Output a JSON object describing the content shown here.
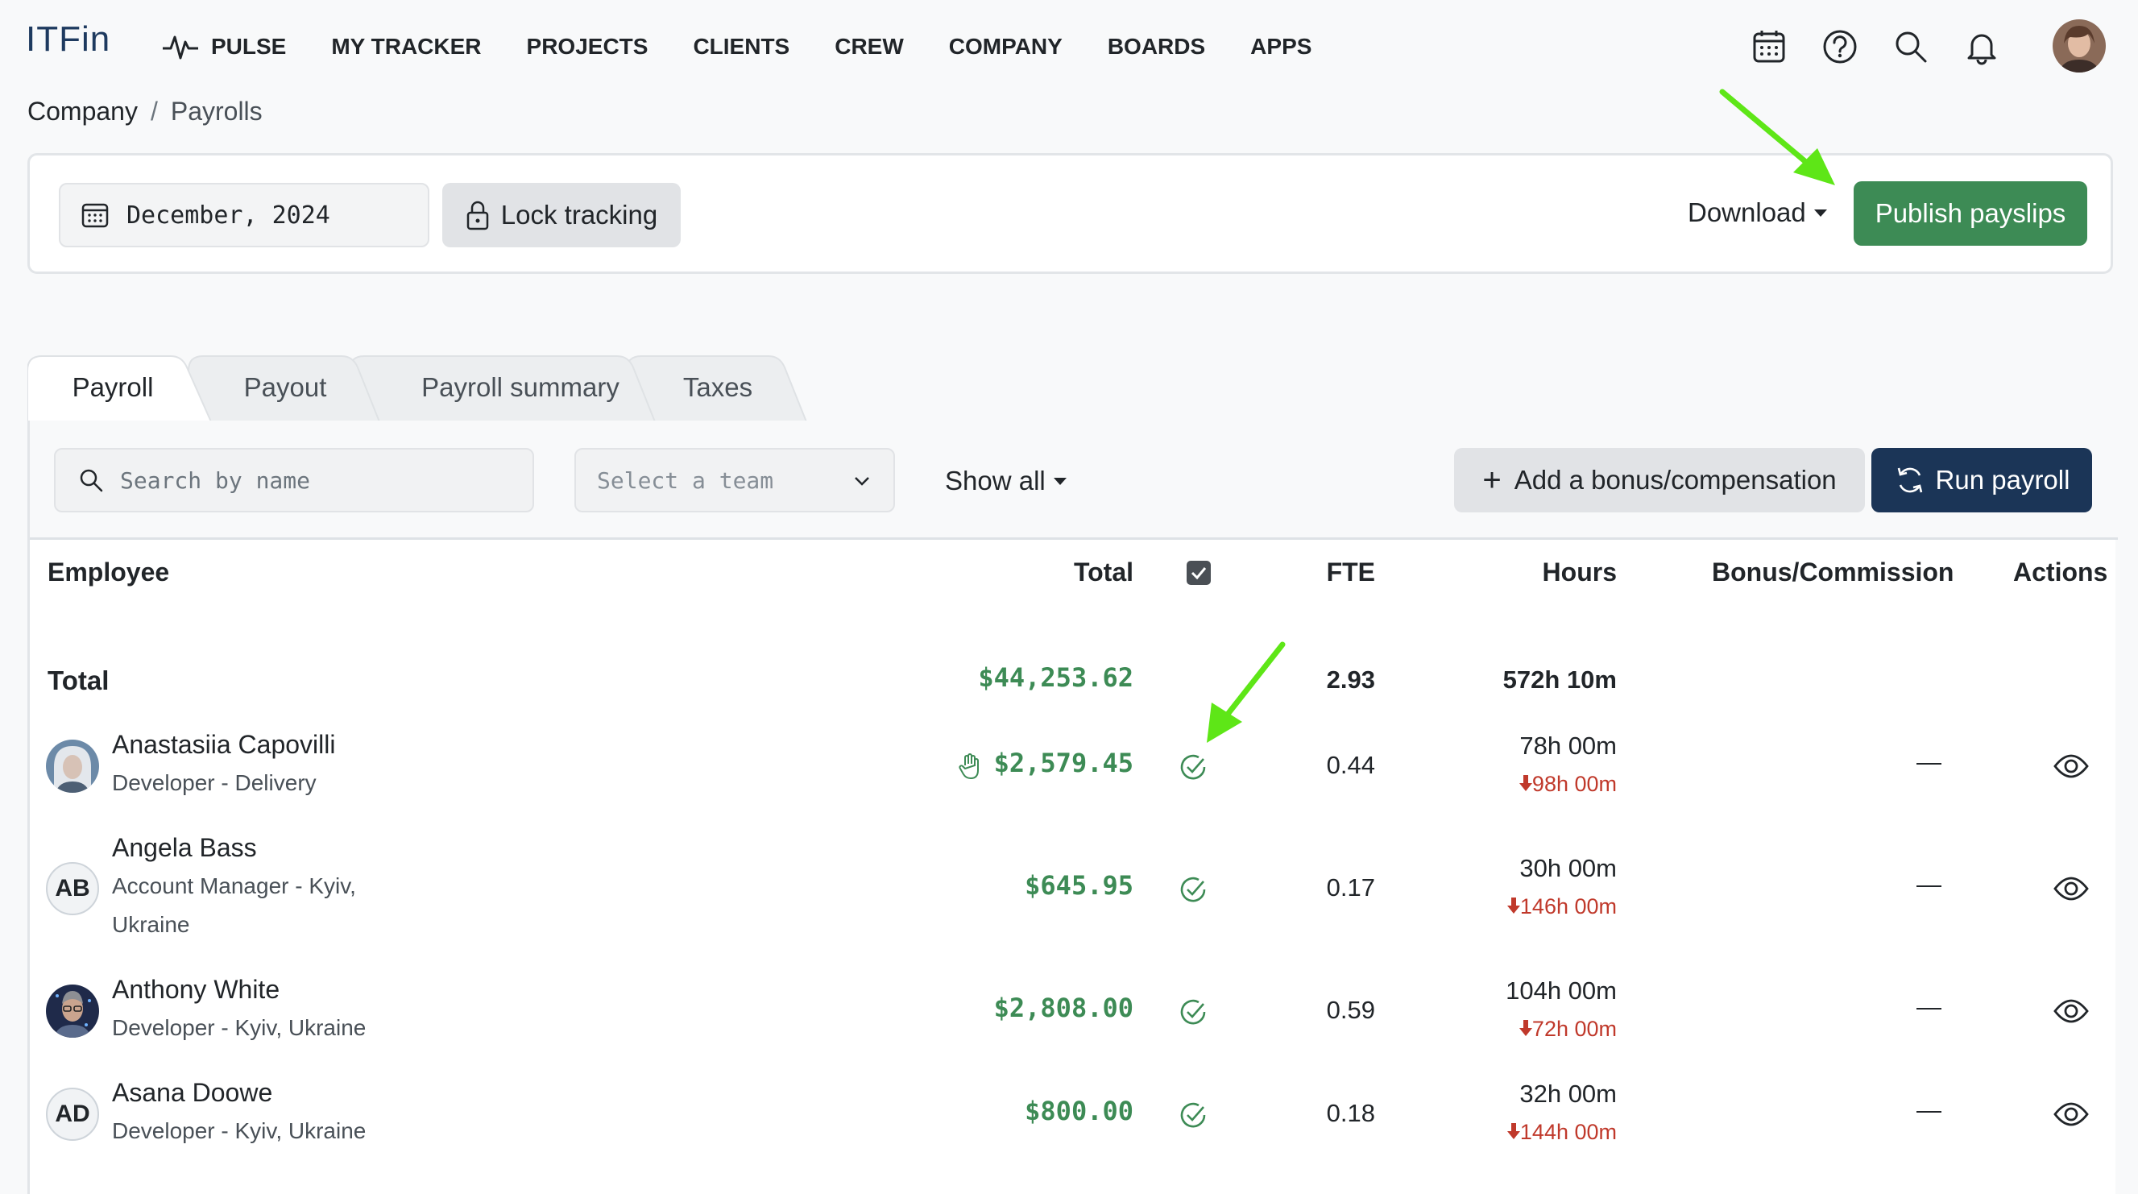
{
  "app": {
    "logo": "ITFin"
  },
  "nav": {
    "items": [
      "PULSE",
      "MY TRACKER",
      "PROJECTS",
      "CLIENTS",
      "CREW",
      "COMPANY",
      "BOARDS",
      "APPS"
    ],
    "icons": [
      "calendar-icon",
      "help-icon",
      "search-icon",
      "bell-icon"
    ]
  },
  "breadcrumb": {
    "parent": "Company",
    "separator": "/",
    "current": "Payrolls"
  },
  "toolbar": {
    "period": "December, 2024",
    "lock_label": "Lock tracking",
    "download_label": "Download",
    "publish_label": "Publish payslips"
  },
  "tabs": [
    "Payroll",
    "Payout",
    "Payroll summary",
    "Taxes"
  ],
  "filters": {
    "search_placeholder": "Search by name",
    "team_placeholder": "Select a team",
    "show_all_label": "Show all",
    "add_bonus_label": "Add a bonus/compensation",
    "run_payroll_label": "Run payroll"
  },
  "table": {
    "headers": {
      "employee": "Employee",
      "total": "Total",
      "fte": "FTE",
      "hours": "Hours",
      "bonus": "Bonus/Commission",
      "actions": "Actions"
    },
    "totals": {
      "label": "Total",
      "total": "$44,253.62",
      "fte": "2.93",
      "hours": "572h 10m"
    },
    "rows": [
      {
        "name": "Anastasiia Capovilli",
        "role_line1": "Developer - Delivery",
        "role_line2": "",
        "avatar": "photo",
        "total": "$2,579.45",
        "manual_flag": true,
        "fte": "0.44",
        "hours": "78h 00m",
        "hours_diff": "98h 00m",
        "bonus": "—"
      },
      {
        "name": "Angela Bass",
        "role_line1": "Account Manager - Kyiv,",
        "role_line2": "Ukraine",
        "avatar": "AB",
        "total": "$645.95",
        "manual_flag": false,
        "fte": "0.17",
        "hours": "30h 00m",
        "hours_diff": "146h 00m",
        "bonus": "—"
      },
      {
        "name": "Anthony White",
        "role_line1": "Developer - Kyiv, Ukraine",
        "role_line2": "",
        "avatar": "photo",
        "total": "$2,808.00",
        "manual_flag": false,
        "fte": "0.59",
        "hours": "104h 00m",
        "hours_diff": "72h 00m",
        "bonus": "—"
      },
      {
        "name": "Asana Doowe",
        "role_line1": "Developer - Kyiv, Ukraine",
        "role_line2": "",
        "avatar": "AD",
        "total": "$800.00",
        "manual_flag": false,
        "fte": "0.18",
        "hours": "32h 00m",
        "hours_diff": "144h 00m",
        "bonus": "—"
      }
    ]
  },
  "colors": {
    "accent_green": "#3d8b55",
    "navy": "#1b3557",
    "negative_red": "#c0392b",
    "annotation_arrow": "#5ee617"
  }
}
